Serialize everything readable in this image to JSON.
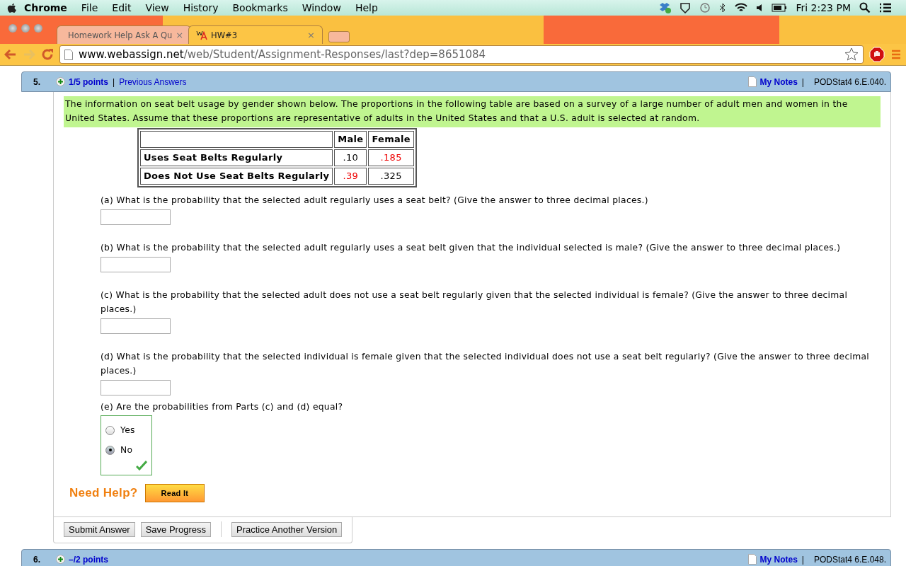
{
  "menubar": {
    "app": "Chrome",
    "menus": [
      "File",
      "Edit",
      "View",
      "History",
      "Bookmarks",
      "Window",
      "Help"
    ],
    "clock": "Fri 2:23 PM"
  },
  "tabs": [
    {
      "title": "Homework Help Ask A Qu",
      "close": "×",
      "selected": false
    },
    {
      "title": "HW#3",
      "close": "×",
      "selected": true
    }
  ],
  "address": {
    "host": "www.webassign.net",
    "path": "/web/Student/Assignment-Responses/last?dep=8651084"
  },
  "question": {
    "separator": "|",
    "number": "5.",
    "points": "1/5 points",
    "previous": "Previous Answers",
    "notes": "My Notes",
    "code": "PODStat4 6.E.040.",
    "intro": "The information on seat belt usage by gender shown below. The proportions in the following table are based on a survey of a large number of adult men and women in the United States. Assume that these proportions are representative of adults in the United States and that a U.S. adult is selected at random.",
    "table": {
      "columns": [
        "Male",
        "Female"
      ],
      "rows": [
        {
          "label": "Uses Seat Belts Regularly",
          "cells": [
            {
              "value": ".10",
              "highlighted": false
            },
            {
              "value": ".185",
              "highlighted": true
            }
          ]
        },
        {
          "label": "Does Not Use Seat Belts Regularly",
          "cells": [
            {
              "value": ".39",
              "highlighted": true
            },
            {
              "value": ".325",
              "highlighted": false
            }
          ]
        }
      ]
    },
    "parts": [
      {
        "kind": "text",
        "prompt": "(a) What is the probability that the selected adult regularly uses a seat belt? (Give the answer to three decimal places.)"
      },
      {
        "kind": "text",
        "prompt": "(b) What is the probability that the selected adult regularly uses a seat belt given that the individual selected is male? (Give the answer to three decimal places.)"
      },
      {
        "kind": "text",
        "prompt": "(c) What is the probability that the selected adult does not use a seat belt regularly given that the selected individual is female? (Give the answer to three decimal places.)"
      },
      {
        "kind": "text",
        "prompt": "(d) What is the probability that the selected individual is female given that the selected individual does not use a seat belt regularly? (Give the answer to three decimal places.)"
      },
      {
        "kind": "radio",
        "prompt": "(e) Are the probabilities from Parts (c) and (d) equal?",
        "correct": true,
        "options": [
          {
            "label": "Yes",
            "selected": false
          },
          {
            "label": "No",
            "selected": true
          }
        ]
      }
    ],
    "help": {
      "label": "Need Help?",
      "button": "Read It"
    },
    "buttons": [
      "Submit Answer",
      "Save Progress",
      "Practice Another Version"
    ]
  },
  "next_question": {
    "separator": "|",
    "number": "6.",
    "points": "–/2 points",
    "notes": "My Notes",
    "code": "PODStat4 6.E.048."
  }
}
